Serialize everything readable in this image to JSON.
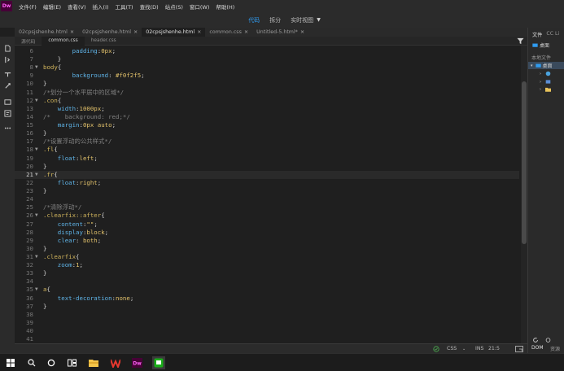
{
  "app": {
    "logo": "Dw",
    "menu": [
      "文件(F)",
      "编辑(E)",
      "查看(V)",
      "插入(I)",
      "工具(T)",
      "查找(D)",
      "站点(S)",
      "窗口(W)",
      "帮助(H)"
    ]
  },
  "view_modes": {
    "code": "代码",
    "split": "拆分",
    "live": "实时视图",
    "active": "代码"
  },
  "document_tabs": [
    {
      "label": "02cpsjshenhe.html",
      "close": "×",
      "active": false
    },
    {
      "label": "02cpsjshenhe.html",
      "close": "×",
      "active": false
    },
    {
      "label": "02cpsjshenhe.html",
      "close": "×",
      "active": true
    },
    {
      "label": "common.css",
      "close": "×",
      "active": false
    },
    {
      "label": "Untitled-5.html*",
      "close": "×",
      "active": false
    }
  ],
  "related_files": [
    "源代码",
    "common.css",
    "header.css"
  ],
  "related_active": "common.css",
  "editor": {
    "current_line": "21",
    "lines": [
      {
        "n": "6",
        "fold": "",
        "t": "        padding:0px;"
      },
      {
        "n": "7",
        "fold": "",
        "t": "    }"
      },
      {
        "n": "8",
        "fold": "▼",
        "t": "body{"
      },
      {
        "n": "9",
        "fold": "",
        "t": "        background: #f0f2f5;"
      },
      {
        "n": "10",
        "fold": "",
        "t": "}"
      },
      {
        "n": "11",
        "fold": "",
        "t": "/*划分一个水平居中的区域*/"
      },
      {
        "n": "12",
        "fold": "▼",
        "t": ".con{"
      },
      {
        "n": "13",
        "fold": "",
        "t": "    width:1000px;"
      },
      {
        "n": "14",
        "fold": "",
        "t": "/*    background: red;*/"
      },
      {
        "n": "15",
        "fold": "",
        "t": "    margin:0px auto;"
      },
      {
        "n": "16",
        "fold": "",
        "t": "}"
      },
      {
        "n": "17",
        "fold": "",
        "t": "/*设置浮动的公共样式*/"
      },
      {
        "n": "18",
        "fold": "▼",
        "t": ".fl{"
      },
      {
        "n": "19",
        "fold": "",
        "t": "    float:left;"
      },
      {
        "n": "20",
        "fold": "",
        "t": "}"
      },
      {
        "n": "21",
        "fold": "▼",
        "t": ".fr{"
      },
      {
        "n": "22",
        "fold": "",
        "t": "    float:right;"
      },
      {
        "n": "23",
        "fold": "",
        "t": "}"
      },
      {
        "n": "24",
        "fold": "",
        "t": ""
      },
      {
        "n": "25",
        "fold": "",
        "t": "/*清除浮动*/"
      },
      {
        "n": "26",
        "fold": "▼",
        "t": ".clearfix::after{"
      },
      {
        "n": "27",
        "fold": "",
        "t": "    content:\"\";"
      },
      {
        "n": "28",
        "fold": "",
        "t": "    display:block;"
      },
      {
        "n": "29",
        "fold": "",
        "t": "    clear: both;"
      },
      {
        "n": "30",
        "fold": "",
        "t": "}"
      },
      {
        "n": "31",
        "fold": "▼",
        "t": ".clearfix{"
      },
      {
        "n": "32",
        "fold": "",
        "t": "    zoom:1;"
      },
      {
        "n": "33",
        "fold": "",
        "t": "}"
      },
      {
        "n": "34",
        "fold": "",
        "t": ""
      },
      {
        "n": "35",
        "fold": "▼",
        "t": "a{"
      },
      {
        "n": "36",
        "fold": "",
        "t": "    text-decoration:none;"
      },
      {
        "n": "37",
        "fold": "",
        "t": "}"
      },
      {
        "n": "38",
        "fold": "",
        "t": ""
      },
      {
        "n": "39",
        "fold": "",
        "t": ""
      },
      {
        "n": "40",
        "fold": "",
        "t": ""
      },
      {
        "n": "41",
        "fold": "",
        "t": ""
      }
    ]
  },
  "status": {
    "ok_icon": "check-circle-icon",
    "language": "CSS",
    "mode": "INS",
    "position": "21:5"
  },
  "right_panel": {
    "tabs": [
      "文件",
      "CC Li"
    ],
    "location": "桌面",
    "local_files": "本地文件",
    "root": "桌面",
    "bottom_tabs": [
      "DOM",
      "资源"
    ]
  },
  "colors": {
    "accent": "#2f9bf0",
    "editor_bg": "#1f1f1f",
    "text": "#d4d4d4",
    "keyword": "#5fb4e8",
    "selector": "#d0b45c",
    "value": "#e3c26b",
    "comment": "#808080",
    "dw_brand": "#ff61f6"
  }
}
